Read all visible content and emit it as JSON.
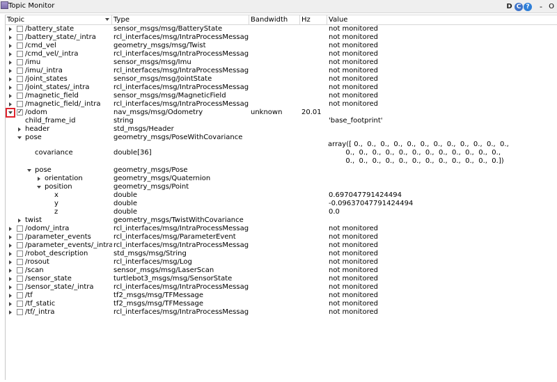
{
  "window": {
    "title": "Topic Monitor",
    "btn_d": "D",
    "btn_reload": "C",
    "btn_help": "?",
    "btn_min": "-",
    "btn_close": "O"
  },
  "columns": [
    "Topic",
    "Type",
    "Bandwidth",
    "Hz",
    "Value"
  ],
  "rows": [
    {
      "topic": "/battery_state",
      "type": "sensor_msgs/msg/BatteryState",
      "bw": "",
      "hz": "",
      "value": "not monitored"
    },
    {
      "topic": "/battery_state/_intra",
      "type": "rcl_interfaces/msg/IntraProcessMessage",
      "bw": "",
      "hz": "",
      "value": "not monitored"
    },
    {
      "topic": "/cmd_vel",
      "type": "geometry_msgs/msg/Twist",
      "bw": "",
      "hz": "",
      "value": "not monitored"
    },
    {
      "topic": "/cmd_vel/_intra",
      "type": "rcl_interfaces/msg/IntraProcessMessage",
      "bw": "",
      "hz": "",
      "value": "not monitored"
    },
    {
      "topic": "/imu",
      "type": "sensor_msgs/msg/Imu",
      "bw": "",
      "hz": "",
      "value": "not monitored"
    },
    {
      "topic": "/imu/_intra",
      "type": "rcl_interfaces/msg/IntraProcessMessage",
      "bw": "",
      "hz": "",
      "value": "not monitored"
    },
    {
      "topic": "/joint_states",
      "type": "sensor_msgs/msg/JointState",
      "bw": "",
      "hz": "",
      "value": "not monitored"
    },
    {
      "topic": "/joint_states/_intra",
      "type": "rcl_interfaces/msg/IntraProcessMessage",
      "bw": "",
      "hz": "",
      "value": "not monitored"
    },
    {
      "topic": "/magnetic_field",
      "type": "sensor_msgs/msg/MagneticField",
      "bw": "",
      "hz": "",
      "value": "not monitored"
    },
    {
      "topic": "/magnetic_field/_intra",
      "type": "rcl_interfaces/msg/IntraProcessMessage",
      "bw": "",
      "hz": "",
      "value": "not monitored"
    },
    {
      "topic": "/odom",
      "type": "nav_msgs/msg/Odometry",
      "bw": "unknown",
      "hz": "20.01",
      "value": ""
    },
    {
      "topic": "child_frame_id",
      "type": "string",
      "bw": "",
      "hz": "",
      "value": "'base_footprint'"
    },
    {
      "topic": "header",
      "type": "std_msgs/Header",
      "bw": "",
      "hz": "",
      "value": ""
    },
    {
      "topic": "pose",
      "type": "geometry_msgs/PoseWithCovariance",
      "bw": "",
      "hz": "",
      "value": ""
    },
    {
      "topic": "covariance",
      "type": "double[36]",
      "bw": "",
      "hz": "",
      "value": ""
    },
    {
      "topic": "pose",
      "type": "geometry_msgs/Pose",
      "bw": "",
      "hz": "",
      "value": ""
    },
    {
      "topic": "orientation",
      "type": "geometry_msgs/Quaternion",
      "bw": "",
      "hz": "",
      "value": ""
    },
    {
      "topic": "position",
      "type": "geometry_msgs/Point",
      "bw": "",
      "hz": "",
      "value": ""
    },
    {
      "topic": "x",
      "type": "double",
      "bw": "",
      "hz": "",
      "value": "0.697047791424494"
    },
    {
      "topic": "y",
      "type": "double",
      "bw": "",
      "hz": "",
      "value": "-0.09637047791424494"
    },
    {
      "topic": "z",
      "type": "double",
      "bw": "",
      "hz": "",
      "value": "0.0"
    },
    {
      "topic": "twist",
      "type": "geometry_msgs/TwistWithCovariance",
      "bw": "",
      "hz": "",
      "value": ""
    },
    {
      "topic": "/odom/_intra",
      "type": "rcl_interfaces/msg/IntraProcessMessage",
      "bw": "",
      "hz": "",
      "value": "not monitored"
    },
    {
      "topic": "/parameter_events",
      "type": "rcl_interfaces/msg/ParameterEvent",
      "bw": "",
      "hz": "",
      "value": "not monitored"
    },
    {
      "topic": "/parameter_events/_intra",
      "type": "rcl_interfaces/msg/IntraProcessMessage",
      "bw": "",
      "hz": "",
      "value": "not monitored"
    },
    {
      "topic": "/robot_description",
      "type": "std_msgs/msg/String",
      "bw": "",
      "hz": "",
      "value": "not monitored"
    },
    {
      "topic": "/rosout",
      "type": "rcl_interfaces/msg/Log",
      "bw": "",
      "hz": "",
      "value": "not monitored"
    },
    {
      "topic": "/scan",
      "type": "sensor_msgs/msg/LaserScan",
      "bw": "",
      "hz": "",
      "value": "not monitored"
    },
    {
      "topic": "/sensor_state",
      "type": "turtlebot3_msgs/msg/SensorState",
      "bw": "",
      "hz": "",
      "value": "not monitored"
    },
    {
      "topic": "/sensor_state/_intra",
      "type": "rcl_interfaces/msg/IntraProcessMessage",
      "bw": "",
      "hz": "",
      "value": "not monitored"
    },
    {
      "topic": "/tf",
      "type": "tf2_msgs/msg/TFMessage",
      "bw": "",
      "hz": "",
      "value": "not monitored"
    },
    {
      "topic": "/tf_static",
      "type": "tf2_msgs/msg/TFMessage",
      "bw": "",
      "hz": "",
      "value": "not monitored"
    },
    {
      "topic": "/tf/_intra",
      "type": "rcl_interfaces/msg/IntraProcessMessage",
      "bw": "",
      "hz": "",
      "value": "not monitored"
    }
  ],
  "covariance_value": [
    "array([ 0.,  0.,  0.,  0.,  0.,  0.,  0.,  0.,  0.,  0.,  0.,  0.,",
    "        0.,  0.,  0.,  0.,  0.,  0.,  0.,  0.,  0.,  0.,  0.,  0.,",
    "        0.,  0.,  0.,  0.,  0.,  0.,  0.,  0.,  0.,  0.,  0.,  0.])"
  ]
}
